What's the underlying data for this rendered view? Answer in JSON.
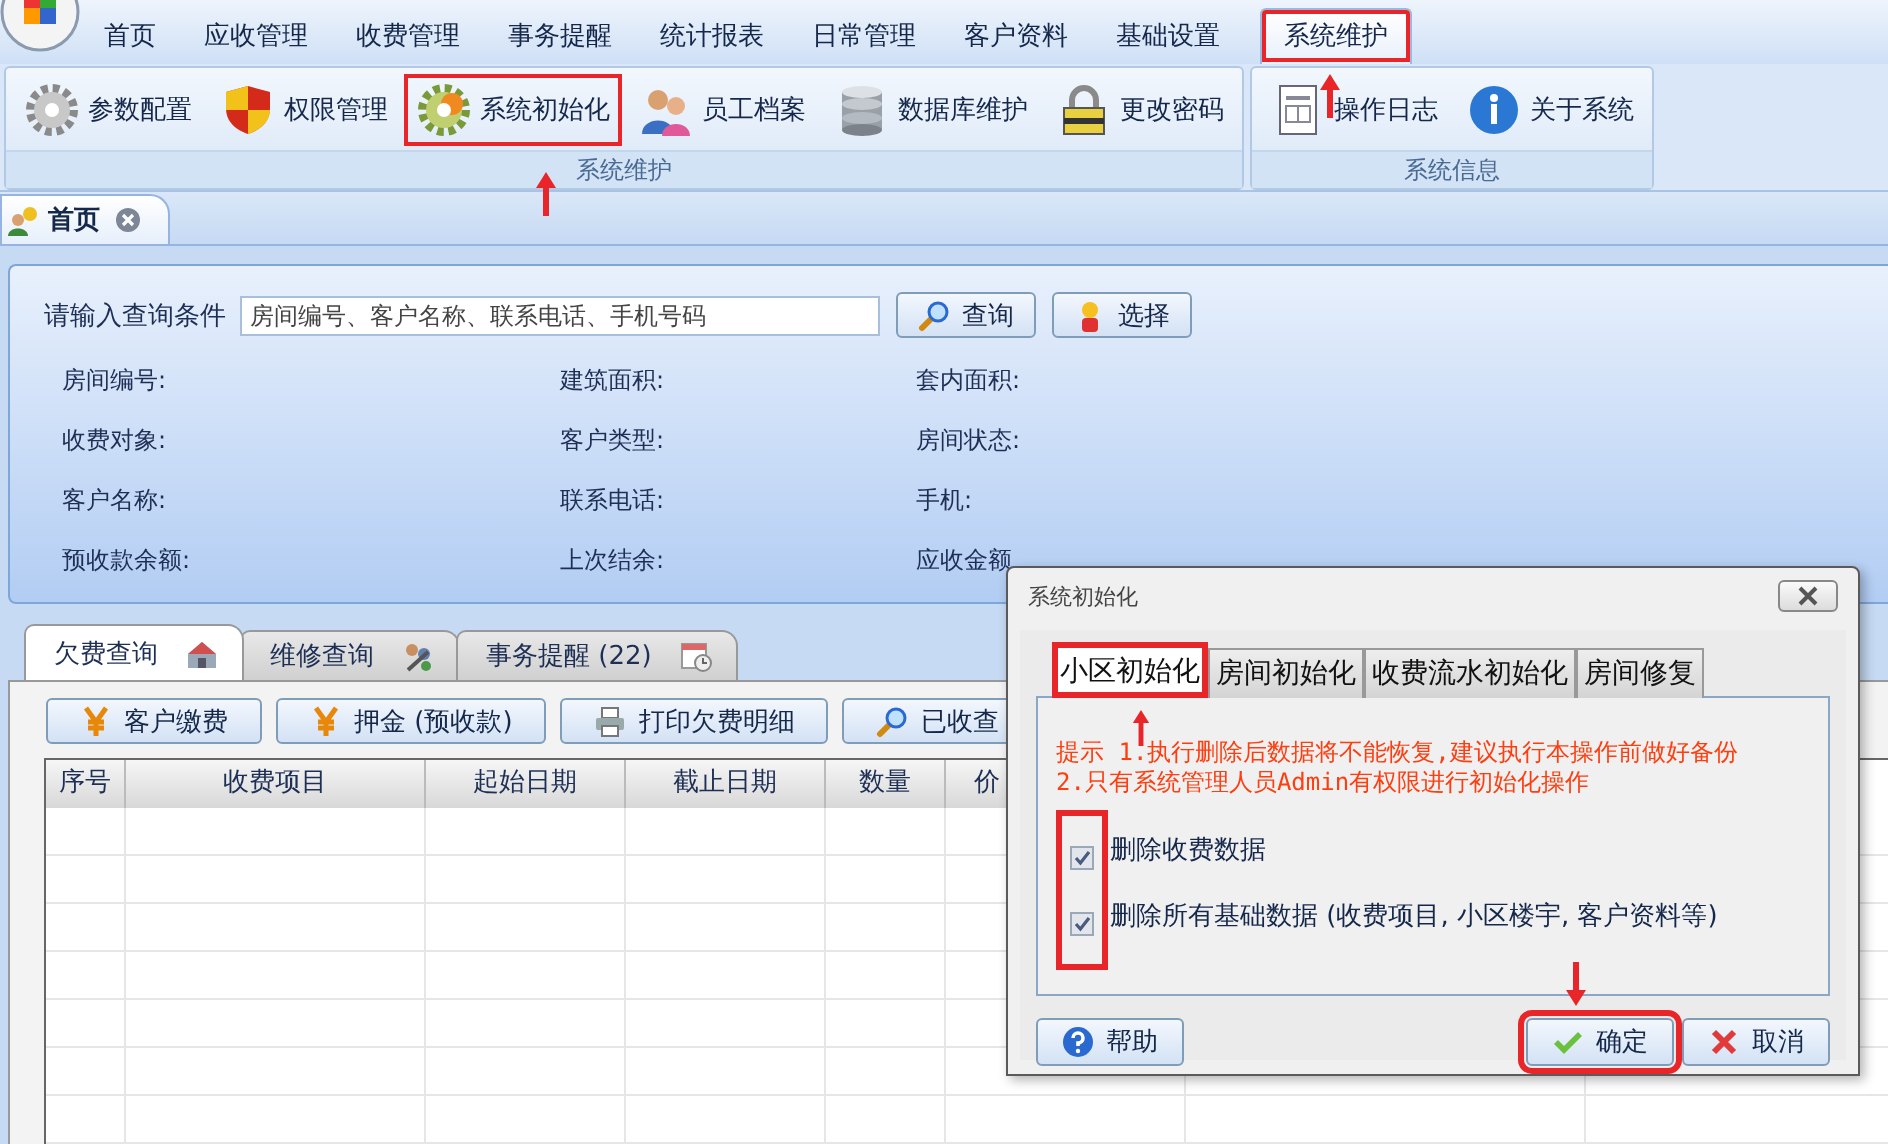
{
  "menu_tabs": [
    {
      "label": "首页",
      "selected": false,
      "highlighted": false
    },
    {
      "label": "应收管理",
      "selected": false,
      "highlighted": false
    },
    {
      "label": "收费管理",
      "selected": false,
      "highlighted": false
    },
    {
      "label": "事务提醒",
      "selected": false,
      "highlighted": false
    },
    {
      "label": "统计报表",
      "selected": false,
      "highlighted": false
    },
    {
      "label": "日常管理",
      "selected": false,
      "highlighted": false
    },
    {
      "label": "客户资料",
      "selected": false,
      "highlighted": false
    },
    {
      "label": "基础设置",
      "selected": false,
      "highlighted": false
    },
    {
      "label": "系统维护",
      "selected": true,
      "highlighted": true
    }
  ],
  "ribbon_groups": [
    {
      "label": "系统维护",
      "buttons": [
        {
          "label": "参数配置",
          "kind": "gear",
          "highlighted": false
        },
        {
          "label": "权限管理",
          "kind": "shield",
          "highlighted": false
        },
        {
          "label": "系统初始化",
          "kind": "gears",
          "highlighted": true
        },
        {
          "label": "员工档案",
          "kind": "people",
          "highlighted": false
        },
        {
          "label": "数据库维护",
          "kind": "database",
          "highlighted": false
        },
        {
          "label": "更改密码",
          "kind": "lock",
          "highlighted": false
        }
      ]
    },
    {
      "label": "系统信息",
      "buttons": [
        {
          "label": "操作日志",
          "kind": "document",
          "highlighted": false
        },
        {
          "label": "关于系统",
          "kind": "info",
          "highlighted": false
        }
      ]
    }
  ],
  "doc_tabs": [
    {
      "label": "首页",
      "selected": true
    }
  ],
  "query": {
    "label": "请输入查询条件",
    "placeholder": "房间编号、客户名称、联系电话、手机号码",
    "buttons": [
      {
        "label": "查询",
        "kind": "search"
      },
      {
        "label": "选择",
        "kind": "person"
      }
    ],
    "fields": [
      "房间编号:",
      "建筑面积:",
      "套内面积:",
      "收费对象:",
      "客户类型:",
      "房间状态:",
      "客户名称:",
      "联系电话:",
      "手机:",
      "预收款余额:",
      "上次结余:",
      "应收金额"
    ]
  },
  "bottom_tabs": [
    {
      "label": "欠费查询",
      "kind": "house",
      "selected": true
    },
    {
      "label": "维修查询",
      "kind": "tools",
      "selected": false
    },
    {
      "label": "事务提醒 (22)",
      "kind": "calendar",
      "selected": false
    }
  ],
  "actions": [
    {
      "label": "客户缴费",
      "kind": "yen"
    },
    {
      "label": "押金 (预收款)",
      "kind": "yen"
    },
    {
      "label": "打印欠费明细",
      "kind": "printer"
    },
    {
      "label": "已收查",
      "kind": "search"
    }
  ],
  "table": {
    "columns": [
      "序号",
      "收费项目",
      "起始日期",
      "截止日期",
      "数量",
      "价"
    ]
  },
  "dialog": {
    "title": "系统初始化",
    "tabs": [
      {
        "label": "小区初始化",
        "selected": true,
        "highlighted": true
      },
      {
        "label": "房间初始化",
        "selected": false,
        "highlighted": false
      },
      {
        "label": "收费流水初始化",
        "selected": false,
        "highlighted": false
      },
      {
        "label": "房间修复",
        "selected": false,
        "highlighted": false
      }
    ],
    "notice": [
      "提示 1.执行删除后数据将不能恢复,建议执行本操作前做好备份",
      "2.只有系统管理人员Admin有权限进行初始化操作"
    ],
    "checkbox_highlight": true,
    "options": [
      {
        "label": "删除收费数据",
        "checked": true
      },
      {
        "label": "删除所有基础数据 (收费项目, 小区楼宇, 客户资料等)",
        "checked": true
      }
    ],
    "buttons": [
      {
        "label": "帮助",
        "kind": "help",
        "highlighted": false
      },
      {
        "label": "确定",
        "kind": "ok",
        "highlighted": true
      },
      {
        "label": "取消",
        "kind": "cancel",
        "highlighted": false
      }
    ]
  }
}
